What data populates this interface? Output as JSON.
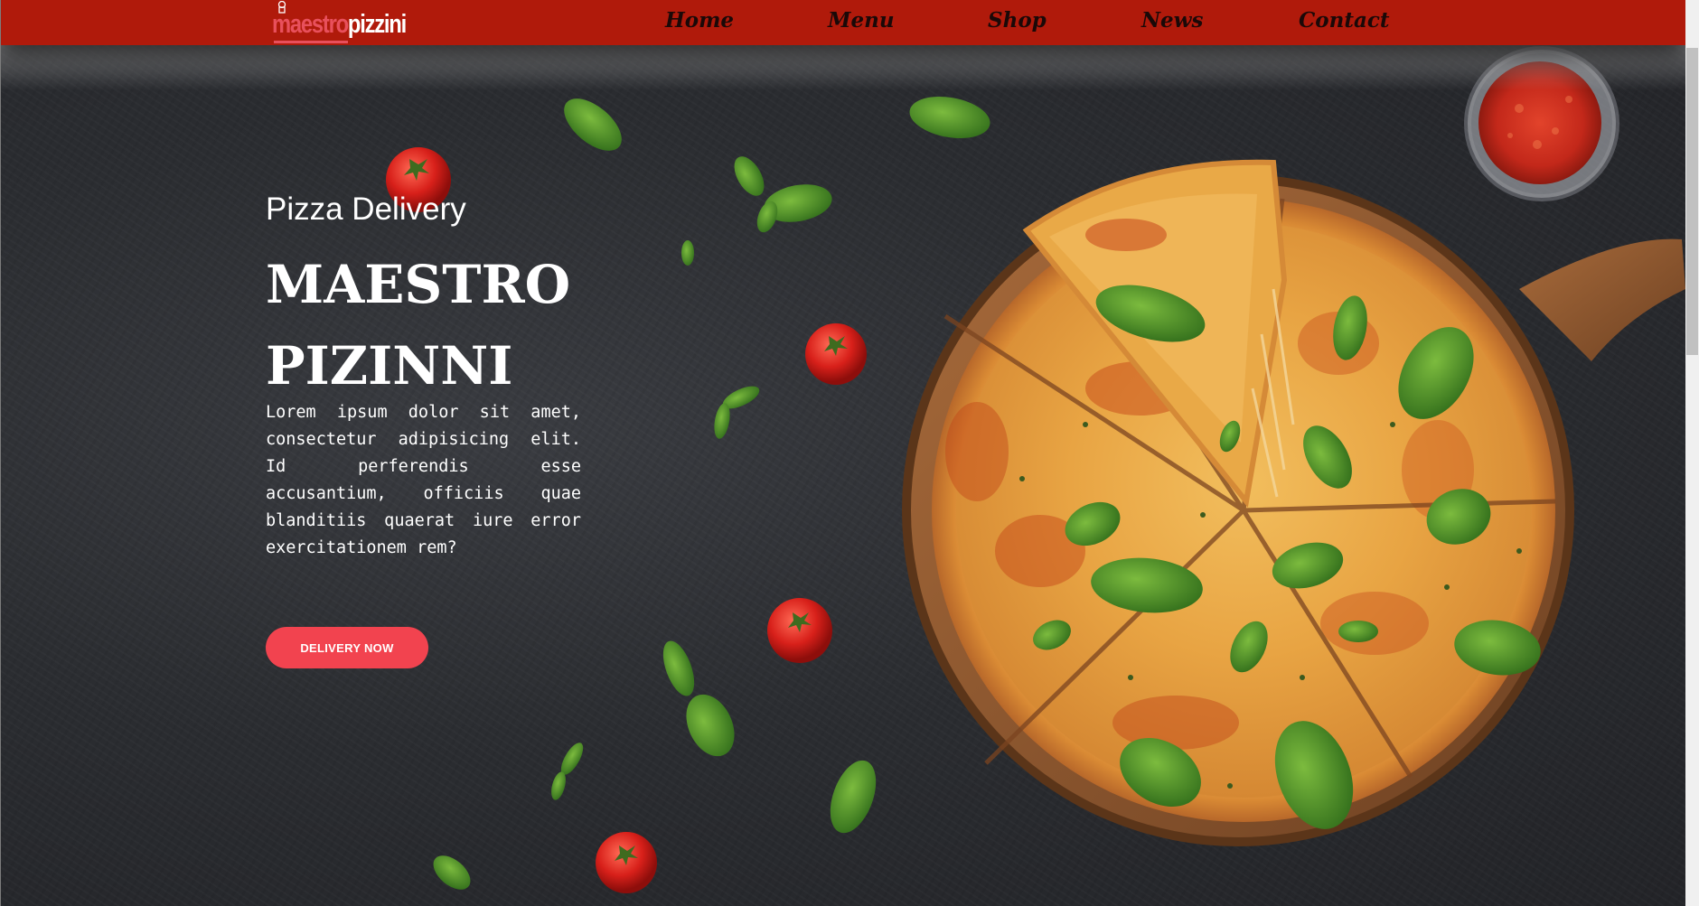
{
  "brand": {
    "logo_part1": "maestro",
    "logo_part2": "pizzini",
    "colors": {
      "header": "#b01a0b",
      "accent": "#f2434f",
      "logo_pink": "#e8505c"
    }
  },
  "nav": {
    "items": [
      {
        "label": "Home"
      },
      {
        "label": "Menu"
      },
      {
        "label": "Shop"
      },
      {
        "label": "News"
      },
      {
        "label": "Contact"
      }
    ]
  },
  "hero": {
    "subtitle": "Pizza Delivery",
    "title_line1": "MAESTRO",
    "title_line2": "PIZINNI",
    "description": "Lorem ipsum dolor sit amet, consectetur adipisicing elit. Id perferendis esse accusantium, officiis quae blanditiis quaerat iure error exercitationem rem?",
    "cta_label": "DELIVERY NOW"
  },
  "icons": [
    "chef-hat-icon",
    "pizza-image",
    "tomato-icon",
    "basil-leaf-icon",
    "sauce-bowl-icon"
  ]
}
